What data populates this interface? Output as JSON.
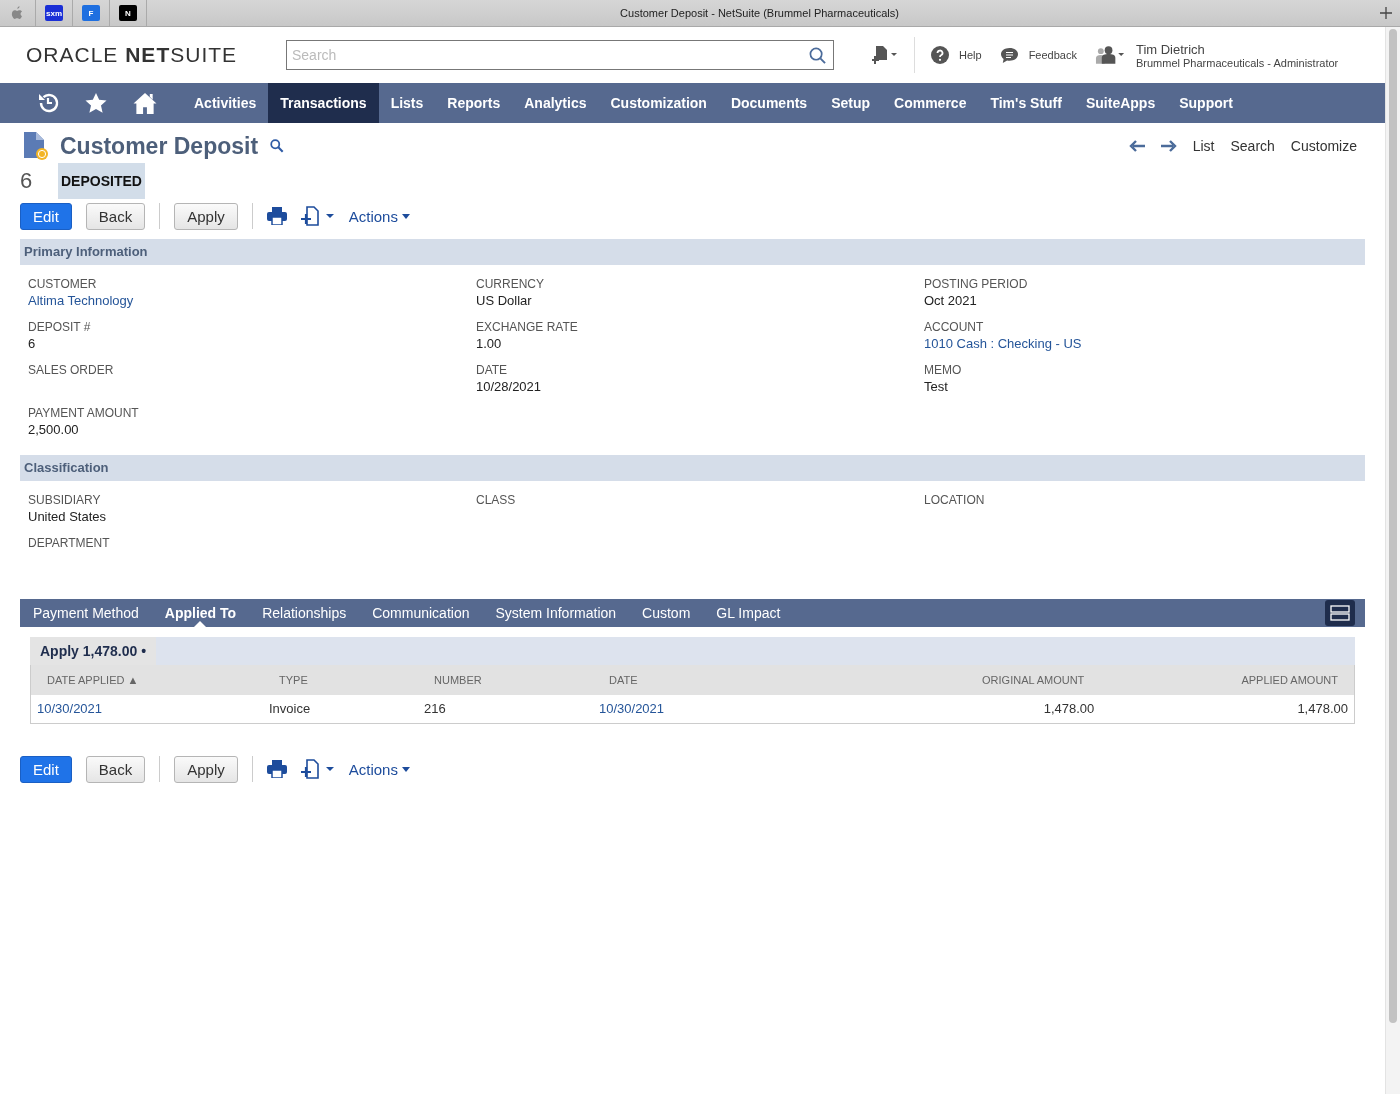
{
  "browser": {
    "title": "Customer Deposit - NetSuite (Brummel Pharmaceuticals)",
    "pinned_tabs": [
      {
        "label": "sxm",
        "color": "#1a2fd6"
      },
      {
        "label": "F",
        "color": "#1e6fe0"
      },
      {
        "label": "N",
        "color": "#000000"
      }
    ]
  },
  "header": {
    "logo": "ORACLE **NET**SUITE",
    "search_placeholder": "Search",
    "help": "Help",
    "feedback": "Feedback",
    "user_name": "Tim Dietrich",
    "user_role": "Brummel Pharmaceuticals - Administrator"
  },
  "nav": [
    {
      "label": "Activities",
      "selected": false
    },
    {
      "label": "Transactions",
      "selected": true
    },
    {
      "label": "Lists",
      "selected": false
    },
    {
      "label": "Reports",
      "selected": false
    },
    {
      "label": "Analytics",
      "selected": false
    },
    {
      "label": "Customization",
      "selected": false
    },
    {
      "label": "Documents",
      "selected": false
    },
    {
      "label": "Setup",
      "selected": false
    },
    {
      "label": "Commerce",
      "selected": false
    },
    {
      "label": "Tim's Stuff",
      "selected": false
    },
    {
      "label": "SuiteApps",
      "selected": false
    },
    {
      "label": "Support",
      "selected": false
    }
  ],
  "record": {
    "type": "Customer Deposit",
    "number": "6",
    "status": "DEPOSITED",
    "links": [
      "List",
      "Search",
      "Customize"
    ]
  },
  "buttons": [
    {
      "label": "Edit",
      "primary": true
    },
    {
      "label": "Back",
      "primary": false
    },
    {
      "label": "Apply",
      "primary": false
    }
  ],
  "actions": "Actions",
  "sections": [
    {
      "title": "Primary Information",
      "columns": [
        [
          {
            "label": "CUSTOMER",
            "value": "Altima Technology",
            "kind": "link"
          },
          {
            "label": "DEPOSIT #",
            "value": "6",
            "kind": "text"
          },
          {
            "label": "SALES ORDER"
          },
          {
            "label": "PAYMENT AMOUNT",
            "value": "2,500.00",
            "kind": "text"
          }
        ],
        [
          {
            "label": "CURRENCY",
            "value": "US Dollar",
            "kind": "text"
          },
          {
            "label": "EXCHANGE RATE",
            "value": "1.00",
            "kind": "text"
          },
          {
            "label": "DATE",
            "value": "10/28/2021",
            "kind": "text"
          }
        ],
        [
          {
            "label": "POSTING PERIOD",
            "value": "Oct 2021",
            "kind": "text"
          },
          {
            "label": "ACCOUNT",
            "value": "1010 Cash : Checking - US",
            "kind": "link"
          },
          {
            "label": "MEMO",
            "value": "Test",
            "kind": "text"
          }
        ]
      ]
    },
    {
      "title": "Classification",
      "columns": [
        [
          {
            "label": "SUBSIDIARY",
            "value": "United States",
            "kind": "text"
          },
          {
            "label": "DEPARTMENT"
          }
        ],
        [
          {
            "label": "CLASS"
          }
        ],
        [
          {
            "label": "LOCATION"
          }
        ]
      ]
    }
  ],
  "subtabs": [
    {
      "label": "Payment Method",
      "selected": false
    },
    {
      "label": "Applied To",
      "selected": true
    },
    {
      "label": "Relationships",
      "selected": false
    },
    {
      "label": "Communication",
      "selected": false
    },
    {
      "label": "System Information",
      "selected": false
    },
    {
      "label": "Custom",
      "selected": false
    },
    {
      "label": "GL Impact",
      "selected": false
    }
  ],
  "apply_tab": "Apply 1,478.00 •",
  "table": {
    "columns": [
      "DATE APPLIED ▲",
      "TYPE",
      "NUMBER",
      "DATE",
      "ORIGINAL AMOUNT",
      "APPLIED AMOUNT"
    ],
    "rows": [
      [
        {
          "value": "10/30/2021",
          "kind": "link"
        },
        {
          "value": "Invoice",
          "kind": "text"
        },
        {
          "value": "216",
          "kind": "text"
        },
        {
          "value": "10/30/2021",
          "kind": "link"
        },
        {
          "value": "1,478.00",
          "kind": "text"
        },
        {
          "value": "1,478.00",
          "kind": "text"
        }
      ]
    ]
  },
  "footer_buttons": [
    {
      "label": "Edit",
      "primary": true
    },
    {
      "label": "Back",
      "primary": false
    },
    {
      "label": "Apply",
      "primary": false
    }
  ],
  "footer_actions": "Actions"
}
